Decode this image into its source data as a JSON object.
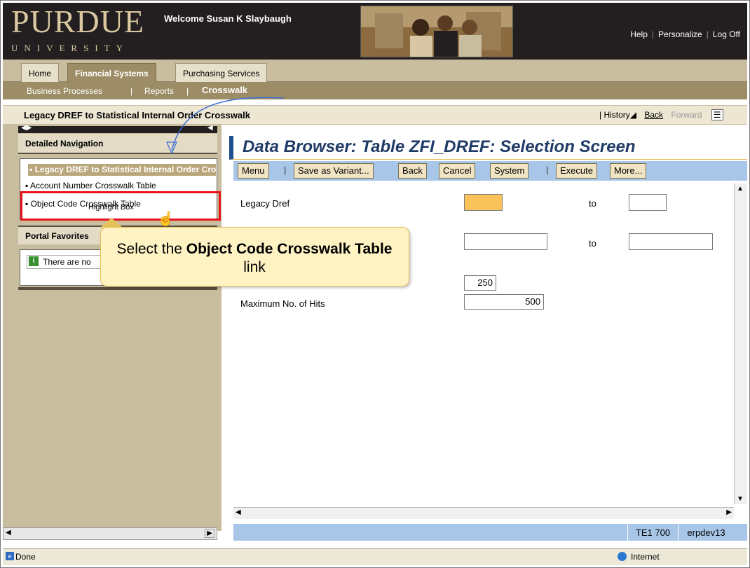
{
  "header": {
    "logo_main": "PURDUE",
    "logo_sub": "UNIVERSITY",
    "welcome": "Welcome Susan K Slaybaugh",
    "links": [
      "Help",
      "Personalize",
      "Log Off"
    ]
  },
  "tabs": [
    {
      "label": "Home"
    },
    {
      "label": "Financial Systems"
    },
    {
      "label": "Purchasing Services"
    }
  ],
  "subnav": [
    "Business Processes",
    "Reports",
    "Crosswalk"
  ],
  "page": {
    "title": "Legacy DREF to Statistical Internal Order Crosswalk",
    "history": "History",
    "back": "Back",
    "forward": "Forward"
  },
  "left_nav": {
    "heading": "Detailed Navigation",
    "items": [
      {
        "label": "Legacy DREF to Statistical Internal Order Crosswalk"
      },
      {
        "label": "Account Number Crosswalk Table"
      },
      {
        "label": "Object Code Crosswalk Table"
      }
    ],
    "favorites_heading": "Portal Favorites",
    "favorites_message": "There are no"
  },
  "main": {
    "title": "Data Browser: Table ZFI_DREF: Selection Screen",
    "toolbar": [
      "Menu",
      "Save as Variant...",
      "Back",
      "Cancel",
      "System",
      "Execute",
      "More..."
    ],
    "fields": [
      {
        "label": "Legacy Dref",
        "to_label": "to",
        "value": "",
        "to_value": ""
      },
      {
        "label": "",
        "to_label": "to",
        "value": "",
        "to_value": ""
      }
    ],
    "width_value": "250",
    "max_hits_label": "Maximum No. of Hits",
    "max_hits_value": "500",
    "status_system": "TE1 700",
    "status_host": "erpdev13"
  },
  "callout": {
    "highlight_label": "Highlight Box",
    "text_prefix": "Select the ",
    "text_bold": "Object Code Crosswalk Table",
    "text_suffix": " link"
  },
  "browser_status": {
    "status": "Done",
    "zone": "Internet"
  },
  "colors": {
    "header_bg": "#231f20",
    "tab_accent": "#9d8d66",
    "sap_blue": "#a8c6e8",
    "highlight_red": "#e8141c",
    "callout_bg": "#fff3c4"
  }
}
